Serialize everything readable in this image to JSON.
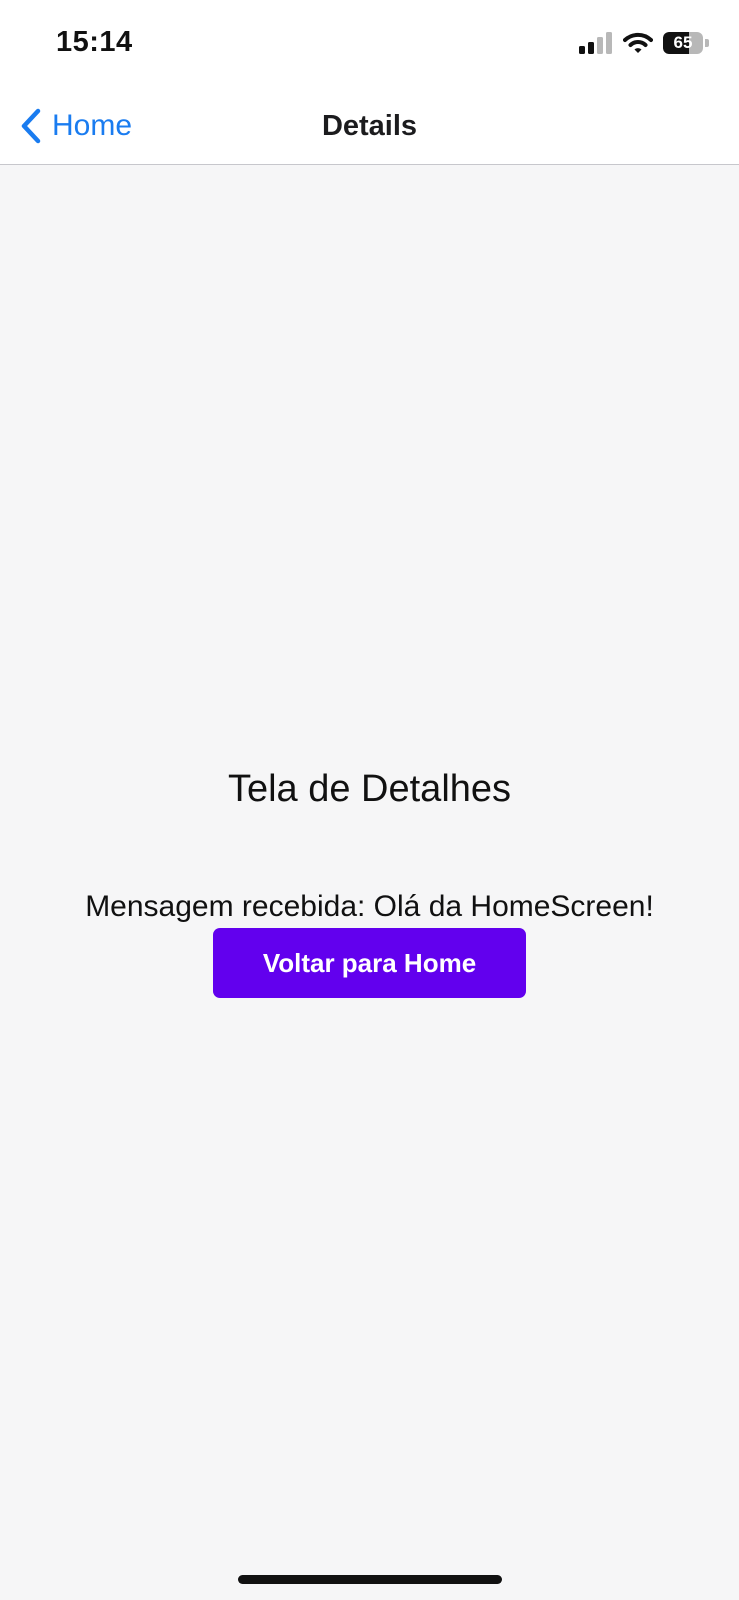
{
  "status_bar": {
    "time": "15:14",
    "battery_level": "65",
    "battery_fraction": 0.65
  },
  "nav_bar": {
    "back_label": "Home",
    "title": "Details"
  },
  "content": {
    "title": "Tela de Detalhes",
    "message": "Mensagem recebida: Olá da HomeScreen!",
    "button_label": "Voltar para Home"
  },
  "colors": {
    "accent_blue": "#1a7cf0",
    "button_purple": "#6200ee",
    "background": "#f6f6f7"
  },
  "icons": {
    "back": "chevron-left-icon",
    "signal": "cellular-signal-icon",
    "wifi": "wifi-icon",
    "battery": "battery-icon"
  }
}
